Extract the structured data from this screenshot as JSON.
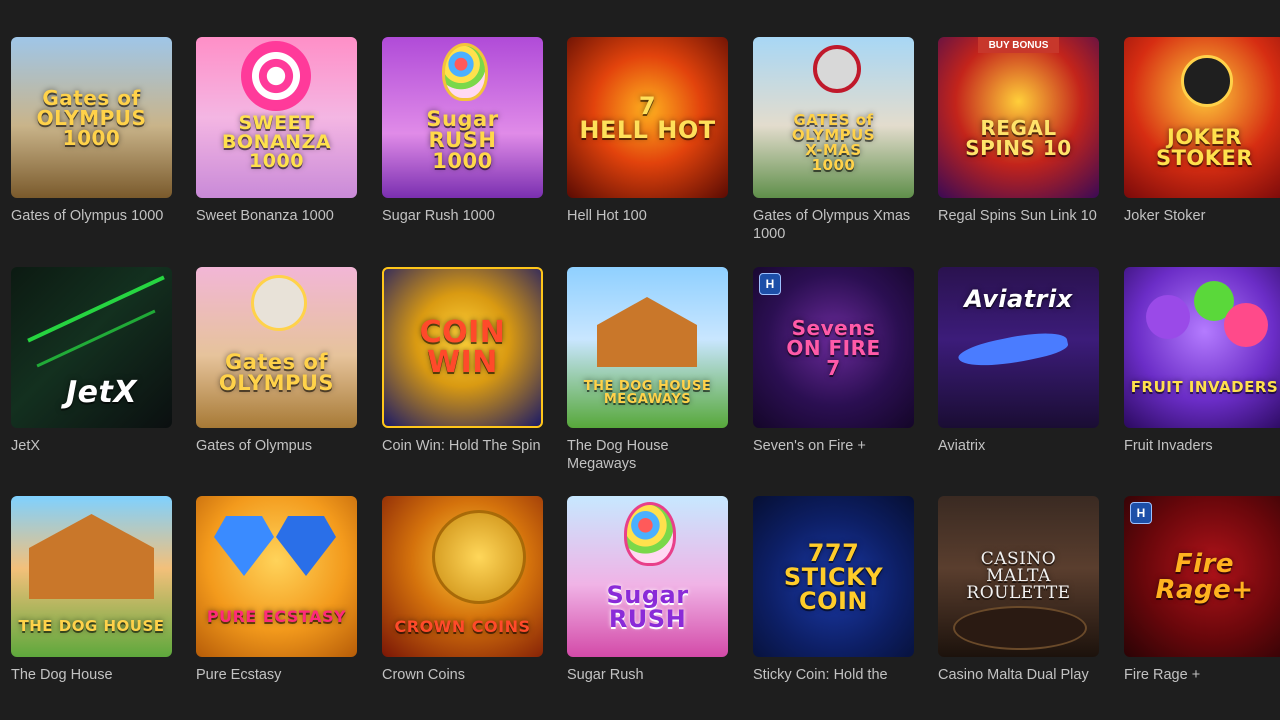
{
  "games": [
    {
      "title": "Gates of Olympus 1000",
      "art": "Gates of\nOLYMPUS\n1000",
      "bg": "linear-gradient(180deg,#9fc6e8 0%,#c9b48a 55%,#7a5a2c 100%)",
      "fg": "#ffd24a"
    },
    {
      "title": "Sweet Bonanza 1000",
      "art": "SWEET\nBONANZA\n1000",
      "bg": "linear-gradient(180deg,#ff8fc7 0%,#f4b6e3 50%,#c98ad8 100%)",
      "fg": "#ffe14d"
    },
    {
      "title": "Sugar Rush 1000",
      "art": "Sugar\nRUSH\n1000",
      "bg": "linear-gradient(180deg,#b04bd8 0%,#e08be8 60%,#7a2fb0 100%)",
      "fg": "#ffd84a"
    },
    {
      "title": "Hell Hot 100",
      "art": "7\nHELL HOT",
      "bg": "radial-gradient(circle at 50% 45%,#ffb11f 0%,#e2430c 45%,#5a0b03 100%)",
      "fg": "#ffe05a"
    },
    {
      "title": "Gates of Olympus Xmas 1000",
      "art": "GATES of OLYMPUS\nX-MAS\n1000",
      "bg": "linear-gradient(180deg,#a8d7f5 0%,#e3dccd 55%,#5f8f4a 100%)",
      "fg": "#ffd24a"
    },
    {
      "title": "Regal Spins Sun Link 10",
      "art": "REGAL\nSPINS 10",
      "bg": "radial-gradient(circle at 50% 40%,#ffcf3a 0%,#c3241b 50%,#3a0a55 100%)",
      "fg": "#ffe36a",
      "ribbon": "BUY BONUS"
    },
    {
      "title": "Joker Stoker",
      "art": "JOKER\nSTOKER",
      "bg": "radial-gradient(circle at 50% 35%,#ffcb3a 0%,#d62d12 55%,#7a0a0a 100%)",
      "fg": "#ffe14d"
    },
    {
      "title": "JetX",
      "art": "JetX",
      "bg": "linear-gradient(135deg,#0c1a12 0%,#13301f 45%,#0b0f10 100%)",
      "fg": "#ffffff"
    },
    {
      "title": "Gates of Olympus",
      "art": "Gates of\nOLYMPUS",
      "bg": "linear-gradient(180deg,#f2b6d6 0%,#e6c39b 55%,#a77a36 100%)",
      "fg": "#ffd24a"
    },
    {
      "title": "Coin Win: Hold The Spin",
      "art": "COIN\nWIN",
      "bg": "radial-gradient(circle at 50% 45%,#ffd23a 0%,#d99a12 40%,#1b1a66 100%)",
      "fg": "#ff4a2a"
    },
    {
      "title": "The Dog House Megaways",
      "art": "THE DOG HOUSE\nMEGAWAYS",
      "bg": "linear-gradient(180deg,#8fd0ff 0%,#c9e6ff 45%,#57a83a 100%)",
      "fg": "#ffd24a"
    },
    {
      "title": "Seven's on Fire +",
      "art": "Sevens\nON FIRE\n7",
      "bg": "radial-gradient(circle at 50% 45%,#6a2a9a 0%,#2b0f52 55%,#140628 100%)",
      "fg": "#ff5aa8",
      "badge": "H"
    },
    {
      "title": "Aviatrix",
      "art": "Aviatrix",
      "bg": "linear-gradient(180deg,#2a124f 0%,#3c1c7a 45%,#1a0d33 100%)",
      "fg": "#ffffff"
    },
    {
      "title": "Fruit Invaders",
      "art": "FRUIT INVADERS",
      "bg": "radial-gradient(circle at 50% 40%,#b47bff 0%,#6b2dc7 55%,#2b0a5f 100%)",
      "fg": "#ffe14d"
    },
    {
      "title": "The Dog House",
      "art": "THE DOG HOUSE",
      "bg": "linear-gradient(180deg,#7fd1ff 0%,#f3c07a 45%,#5ea83c 100%)",
      "fg": "#ffd24a"
    },
    {
      "title": "Pure Ecstasy",
      "art": "PURE ECSTASY",
      "bg": "radial-gradient(circle at 50% 40%,#ffd35a 0%,#f39a1c 55%,#b65c08 100%)",
      "fg": "#ff2a7a"
    },
    {
      "title": "Crown Coins",
      "art": "CROWN COINS",
      "bg": "radial-gradient(circle at 55% 40%,#ffcc3a 0%,#d4720c 45%,#7a1606 100%)",
      "fg": "#ff4a2a"
    },
    {
      "title": "Sugar Rush",
      "art": "Sugar\nRUSH",
      "bg": "linear-gradient(180deg,#c7e8ff 0%,#f0b3e6 55%,#d34aa8 100%)",
      "fg": "#8a2bd8"
    },
    {
      "title": "Sticky Coin: Hold the Spin",
      "art": "777\nSTICKY\nCOIN",
      "bg": "radial-gradient(circle at 50% 55%,#1b3aa8 0%,#0d1f66 55%,#060f33 100%)",
      "fg": "#ffcc2a"
    },
    {
      "title": "Casino Malta Dual Play Roulette",
      "art": "CASINO\nMALTA\nROULETTE",
      "bg": "linear-gradient(180deg,#3a2a22 0%,#5a3e2e 45%,#1c120c 100%)",
      "fg": "#f2f2f2"
    },
    {
      "title": "Fire Rage +",
      "art": "Fire\nRage+",
      "bg": "radial-gradient(circle at 55% 45%,#b0131a 0%,#6a070b 55%,#2a0305 100%)",
      "fg": "#ffb21f",
      "badge": "H"
    }
  ]
}
